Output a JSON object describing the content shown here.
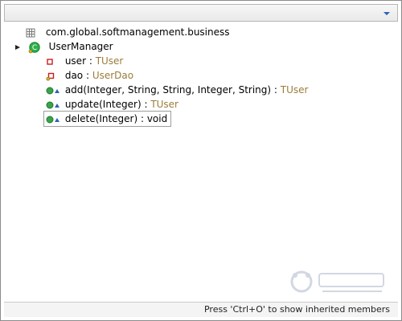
{
  "header": {
    "dropdown_icon": "chevron-down-icon"
  },
  "tree": {
    "package": "com.global.softmanagement.business",
    "class": "UserManager",
    "members": [
      {
        "name": "user",
        "sep": " : ",
        "type": "TUser",
        "icon": "private-field-icon"
      },
      {
        "name": "dao",
        "sep": " : ",
        "type": "UserDao",
        "icon": "private-field-icon"
      },
      {
        "name": "add(Integer, String, String, Integer, String)",
        "sep": " : ",
        "type": "TUser",
        "icon": "public-method-icon"
      },
      {
        "name": "update(Integer)",
        "sep": " : ",
        "type": "TUser",
        "icon": "public-method-icon"
      },
      {
        "name": "delete(Integer) : void",
        "icon": "public-method-icon"
      }
    ]
  },
  "status": {
    "hint": "Press 'Ctrl+O' to show inherited members"
  },
  "colors": {
    "accent": "#2d61b4",
    "type": "#9b7c3a",
    "method": "#3aa34a",
    "field": "#c81e1e"
  }
}
